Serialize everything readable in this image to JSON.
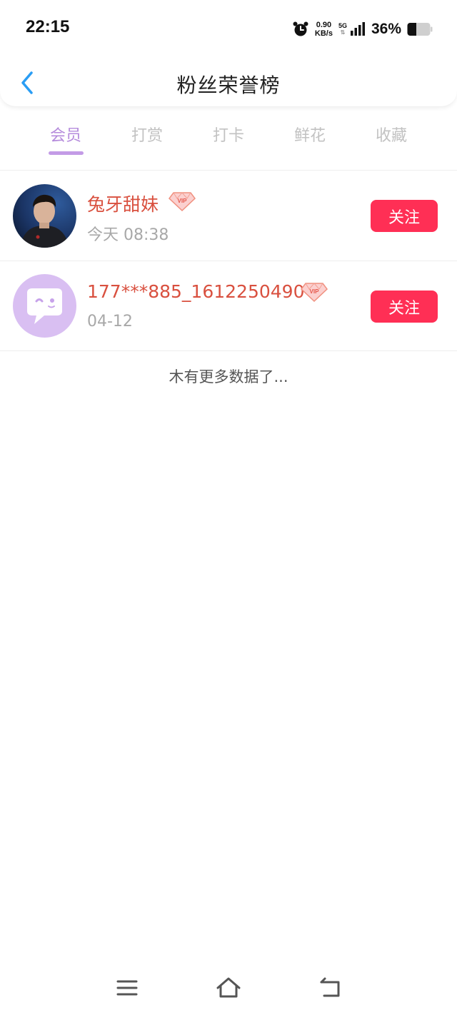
{
  "status_bar": {
    "time": "22:15",
    "net_speed_value": "0.90",
    "net_speed_unit": "KB/s",
    "net_type": "5G",
    "battery": "36%",
    "icons": [
      "alarm-icon",
      "signal-icon",
      "battery-icon"
    ]
  },
  "header": {
    "title": "粉丝荣誉榜",
    "back_icon": "chevron-left-icon"
  },
  "tabs": [
    {
      "label": "会员",
      "active": true
    },
    {
      "label": "打赏",
      "active": false
    },
    {
      "label": "打卡",
      "active": false
    },
    {
      "label": "鲜花",
      "active": false
    },
    {
      "label": "收藏",
      "active": false
    }
  ],
  "fans": [
    {
      "name": "兔牙甜妹",
      "time": "今天 08:38",
      "badge": "VIP",
      "follow_label": "关注",
      "avatar": "photo-avatar"
    },
    {
      "name": "177***885_1612250490",
      "time": "04-12",
      "badge": "VIP",
      "follow_label": "关注",
      "avatar": "default-chat-avatar"
    }
  ],
  "footer": {
    "no_more": "木有更多数据了..."
  },
  "colors": {
    "accent": "#b58bdc",
    "name": "#d9503f",
    "follow": "#ff2f55",
    "back": "#2a9df4"
  },
  "nav_bar": [
    "menu-icon",
    "home-icon",
    "back-icon"
  ]
}
